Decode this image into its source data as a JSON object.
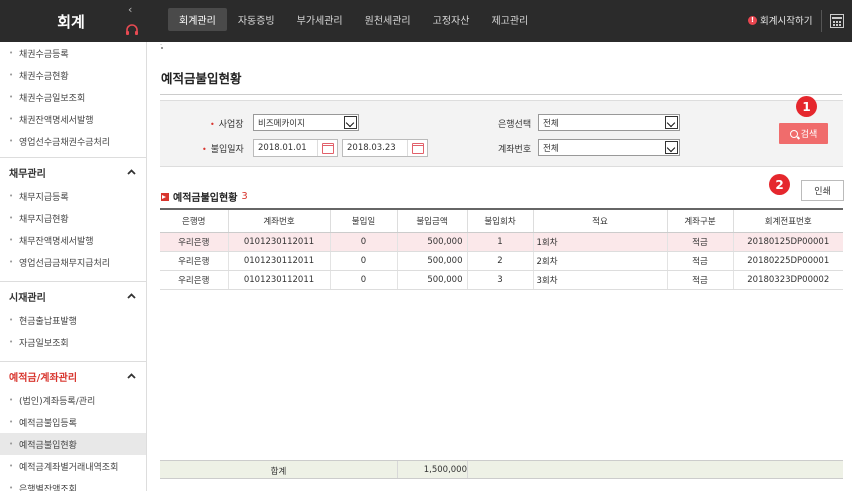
{
  "app": {
    "logo": "회계"
  },
  "topnav": {
    "tabs": [
      "회계관리",
      "자동증빙",
      "부가세관리",
      "원천세관리",
      "고정자산",
      "제고관리"
    ],
    "active_index": 0,
    "start_link": "회계시작하기"
  },
  "sidebar": {
    "group1_items": [
      "채권수금등록",
      "채권수금현황",
      "채권수금일보조회",
      "채권잔액명세서발행",
      "영업선수금채권수금처리"
    ],
    "section2": "채무관리",
    "group2_items": [
      "채무지급등록",
      "채무지급현황",
      "채무잔액명세서발행",
      "영업선급금채무지급처리"
    ],
    "section3": "시재관리",
    "group3_items": [
      "현금출납표발행",
      "자금일보조회"
    ],
    "section4": "예적금/계좌관리",
    "group4_items": [
      "(법인)계좌등록/관리",
      "예적금불입등록",
      "예적금불입현황",
      "예적금계좌별거래내역조회",
      "은행별잔액조회"
    ],
    "selected": "예적금불입현황"
  },
  "page": {
    "breadcrumb": "-",
    "title": "예적금불입현황"
  },
  "search": {
    "workplace_label": "사업장",
    "workplace_value": "비즈메카이지",
    "period_label": "불입일자",
    "date_from": "2018.01.01",
    "date_to": "2018.03.23",
    "bank_label": "은행선택",
    "bank_value": "전체",
    "account_label": "계좌번호",
    "account_value": "전체",
    "search_button": "검색"
  },
  "annotations": {
    "badge1": "1",
    "badge2": "2"
  },
  "result": {
    "title": "예적금불입현황",
    "count": "3",
    "print_button": "인쇄",
    "columns": [
      "은행명",
      "계좌번호",
      "불입일",
      "불입금액",
      "불입회차",
      "적요",
      "계좌구분",
      "회계전표번호"
    ],
    "rows": [
      [
        "우리은행",
        "0101230112011",
        "0",
        "500,000",
        "1",
        "1회차",
        "적금",
        "20180125DP00001"
      ],
      [
        "우리은행",
        "0101230112011",
        "0",
        "500,000",
        "2",
        "2회차",
        "적금",
        "20180225DP00001"
      ],
      [
        "우리은행",
        "0101230112011",
        "0",
        "500,000",
        "3",
        "3회차",
        "적금",
        "20180323DP00002"
      ]
    ],
    "total_label": "합계",
    "total_amount": "1,500,000"
  },
  "colors": {
    "accent": "#d8352e",
    "search_button": "#f06c6c",
    "highlight_row": "#fbe8ea",
    "topbar": "#2b2b2b"
  }
}
